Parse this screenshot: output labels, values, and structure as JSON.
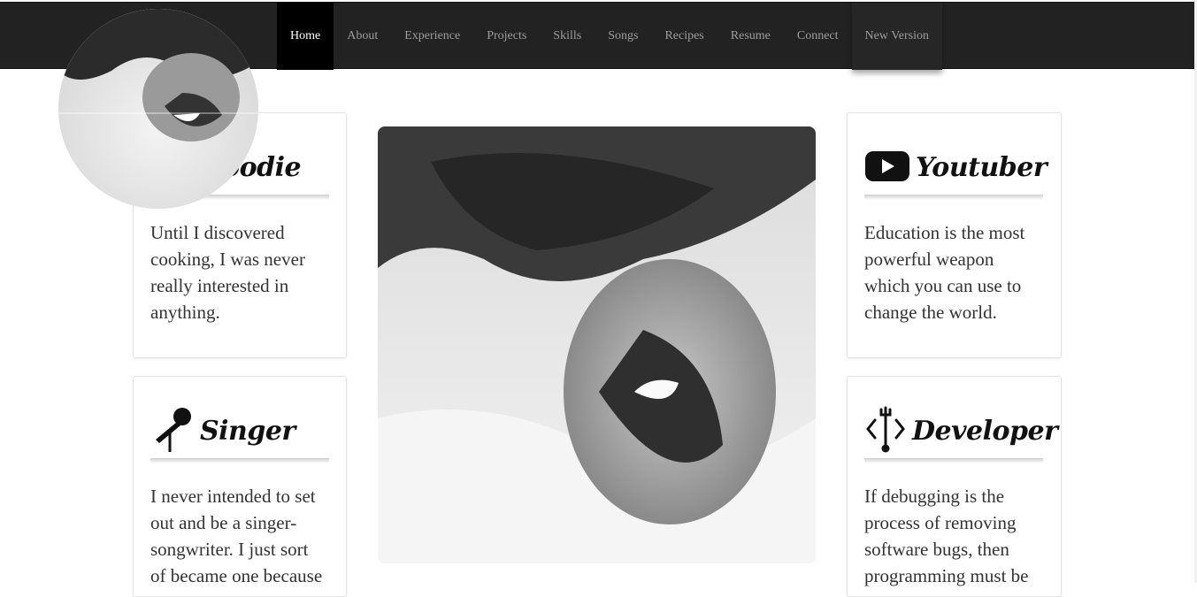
{
  "nav": {
    "items": [
      "Home",
      "About",
      "Experience",
      "Projects",
      "Skills",
      "Songs",
      "Recipes",
      "Resume",
      "Connect",
      "New Version"
    ],
    "active": "Home"
  },
  "cards": {
    "foodie": {
      "title": "Foodie",
      "icon": "fork-knife-icon",
      "text": "Until I discovered cooking, I was never really interested in anything."
    },
    "youtuber": {
      "title": "Youtuber",
      "icon": "youtube-play-icon",
      "text": "Education is the most powerful weapon which you can use to change the world."
    },
    "singer": {
      "title": "Singer",
      "icon": "microphone-icon",
      "text": "I never intended to set out and be a singer-songwriter. I just sort of became one because I"
    },
    "developer": {
      "title": "Developer",
      "icon": "code-wrench-icon",
      "text": "If debugging is the process of removing software bugs, then programming must be"
    }
  },
  "colors": {
    "navbar": "#222222",
    "nav_active": "#000000",
    "nav_text": "#9d9d9d",
    "card_border": "#e4e4e4"
  }
}
